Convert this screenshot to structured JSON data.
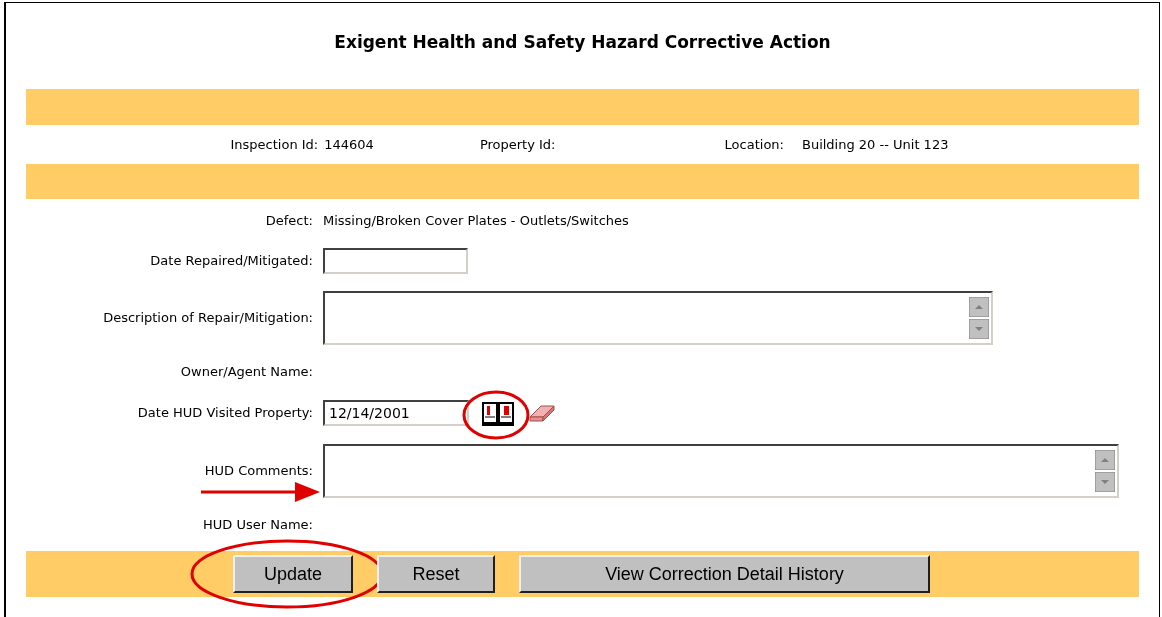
{
  "title": "Exigent Health and Safety Hazard Corrective Action",
  "header": [
    {
      "label": "Inspection Id:",
      "value": "144604"
    },
    {
      "label": "Property Id:"
    },
    {
      "label": "Location:",
      "value": "Building 20 -- Unit 123"
    }
  ],
  "rows": [
    {
      "kind": "text",
      "label": "Defect:",
      "value": "Missing/Broken Cover Plates - Outlets/Switches"
    },
    {
      "kind": "input",
      "label": "Date Repaired/Mitigated:"
    },
    {
      "kind": "textarea",
      "label": "Description of Repair/Mitigation:"
    },
    {
      "kind": "text",
      "label": "Owner/Agent Name:"
    },
    {
      "kind": "date",
      "label": "Date HUD Visited Property:",
      "value": "12/14/2001"
    },
    {
      "kind": "wide_textarea",
      "label": "HUD Comments:"
    },
    {
      "kind": "text",
      "label": "HUD User Name:"
    }
  ],
  "buttons": [
    "Update",
    "Reset",
    "View Correction Detail History"
  ]
}
